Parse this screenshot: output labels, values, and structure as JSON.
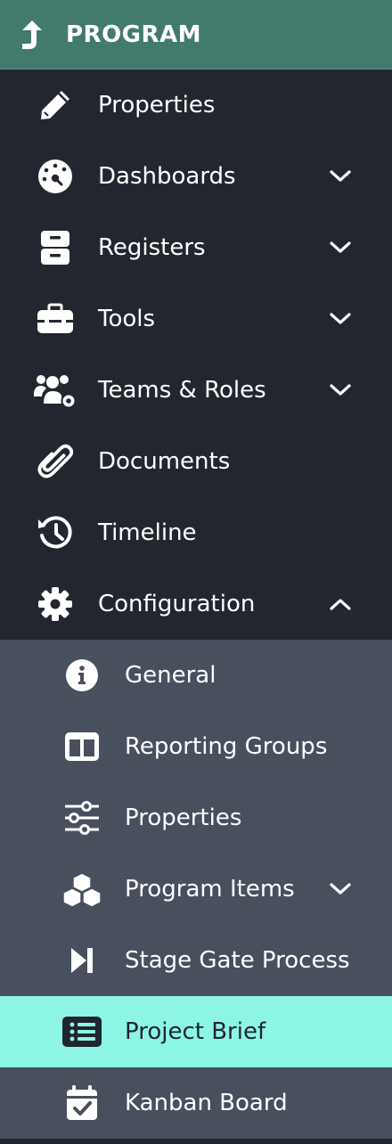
{
  "header": {
    "title": "PROGRAM",
    "icon": "level-up-arrow-icon"
  },
  "colors": {
    "header_bg": "#427a6d",
    "sidebar_bg": "#22272f",
    "submenu_bg": "#48505e",
    "active_bg": "#8cf5e6",
    "active_text": "#1f262d"
  },
  "menu": [
    {
      "label": "Properties",
      "icon": "pencil-icon",
      "expandable": false
    },
    {
      "label": "Dashboards",
      "icon": "gauge-icon",
      "expandable": true,
      "expanded": false
    },
    {
      "label": "Registers",
      "icon": "archive-icon",
      "expandable": true,
      "expanded": false
    },
    {
      "label": "Tools",
      "icon": "toolbox-icon",
      "expandable": true,
      "expanded": false
    },
    {
      "label": "Teams & Roles",
      "icon": "users-cog-icon",
      "expandable": true,
      "expanded": false
    },
    {
      "label": "Documents",
      "icon": "paperclip-icon",
      "expandable": false
    },
    {
      "label": "Timeline",
      "icon": "history-icon",
      "expandable": false
    },
    {
      "label": "Configuration",
      "icon": "gear-icon",
      "expandable": true,
      "expanded": true
    }
  ],
  "submenu": [
    {
      "label": "General",
      "icon": "info-circle-icon"
    },
    {
      "label": "Reporting Groups",
      "icon": "columns-icon"
    },
    {
      "label": "Properties",
      "icon": "sliders-icon"
    },
    {
      "label": "Program Items",
      "icon": "cubes-icon",
      "expandable": true
    },
    {
      "label": "Stage Gate Process",
      "icon": "step-forward-icon"
    },
    {
      "label": "Project Brief",
      "icon": "list-alt-icon",
      "active": true
    },
    {
      "label": "Kanban Board",
      "icon": "calendar-check-icon"
    }
  ]
}
